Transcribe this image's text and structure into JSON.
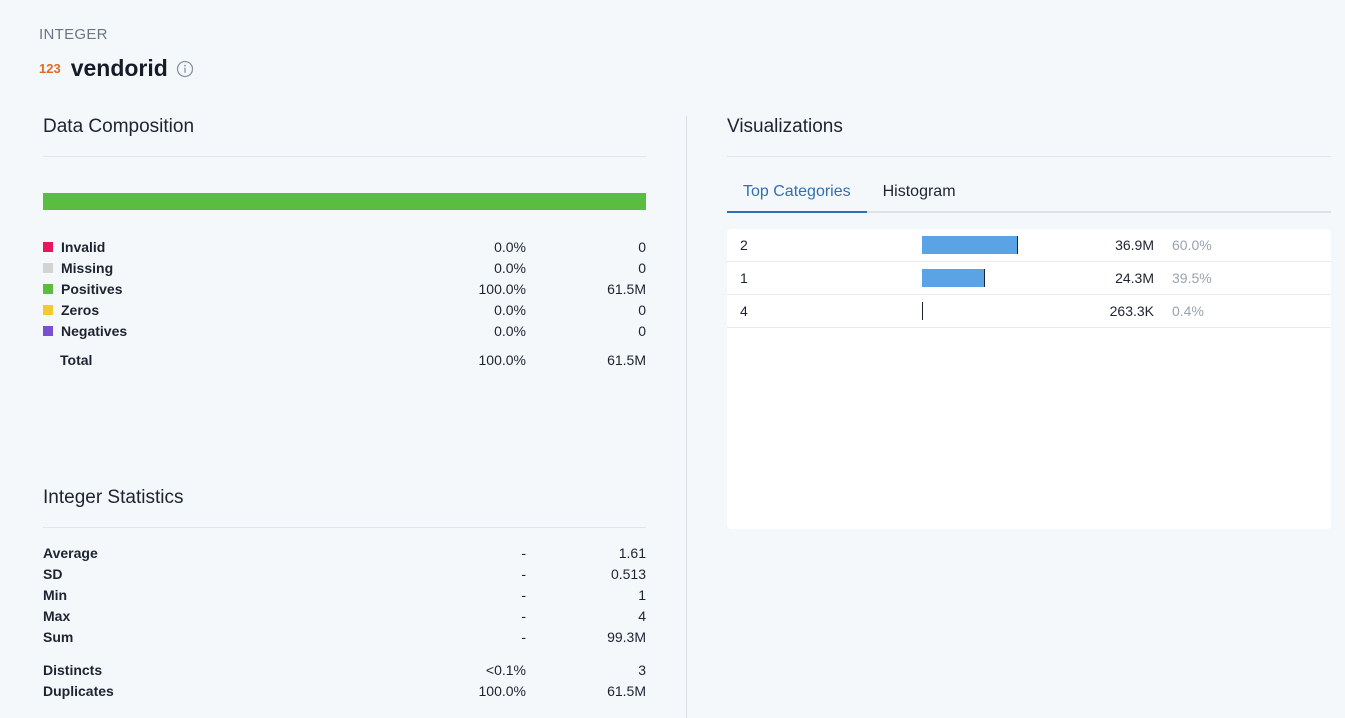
{
  "header": {
    "type_label": "INTEGER",
    "type_icon": "123",
    "column_name": "vendorid"
  },
  "composition": {
    "title": "Data Composition",
    "bar_color": "#5abd42",
    "items": [
      {
        "label": "Invalid",
        "pct": "0.0%",
        "count": "0",
        "color": "#e8175d"
      },
      {
        "label": "Missing",
        "pct": "0.0%",
        "count": "0",
        "color": "#d3d3d3"
      },
      {
        "label": "Positives",
        "pct": "100.0%",
        "count": "61.5M",
        "color": "#5abd42"
      },
      {
        "label": "Zeros",
        "pct": "0.0%",
        "count": "0",
        "color": "#f5c934"
      },
      {
        "label": "Negatives",
        "pct": "0.0%",
        "count": "0",
        "color": "#7b4fd1"
      }
    ],
    "total": {
      "label": "Total",
      "pct": "100.0%",
      "count": "61.5M"
    }
  },
  "stats": {
    "title": "Integer Statistics",
    "items": [
      {
        "label": "Average",
        "pct": "-",
        "value": "1.61"
      },
      {
        "label": "SD",
        "pct": "-",
        "value": "0.513"
      },
      {
        "label": "Min",
        "pct": "-",
        "value": "1"
      },
      {
        "label": "Max",
        "pct": "-",
        "value": "4"
      },
      {
        "label": "Sum",
        "pct": "-",
        "value": "99.3M"
      }
    ],
    "extra": [
      {
        "label": "Distincts",
        "pct": "<0.1%",
        "value": "3"
      },
      {
        "label": "Duplicates",
        "pct": "100.0%",
        "value": "61.5M"
      }
    ]
  },
  "visualizations": {
    "title": "Visualizations",
    "tabs": [
      {
        "label": "Top Categories",
        "active": true
      },
      {
        "label": "Histogram",
        "active": false
      }
    ],
    "categories": [
      {
        "name": "2",
        "count": "36.9M",
        "pct": "60.0%",
        "fraction": 0.6
      },
      {
        "name": "1",
        "count": "24.3M",
        "pct": "39.5%",
        "fraction": 0.395
      },
      {
        "name": "4",
        "count": "263.3K",
        "pct": "0.4%",
        "fraction": 0.004
      }
    ]
  }
}
